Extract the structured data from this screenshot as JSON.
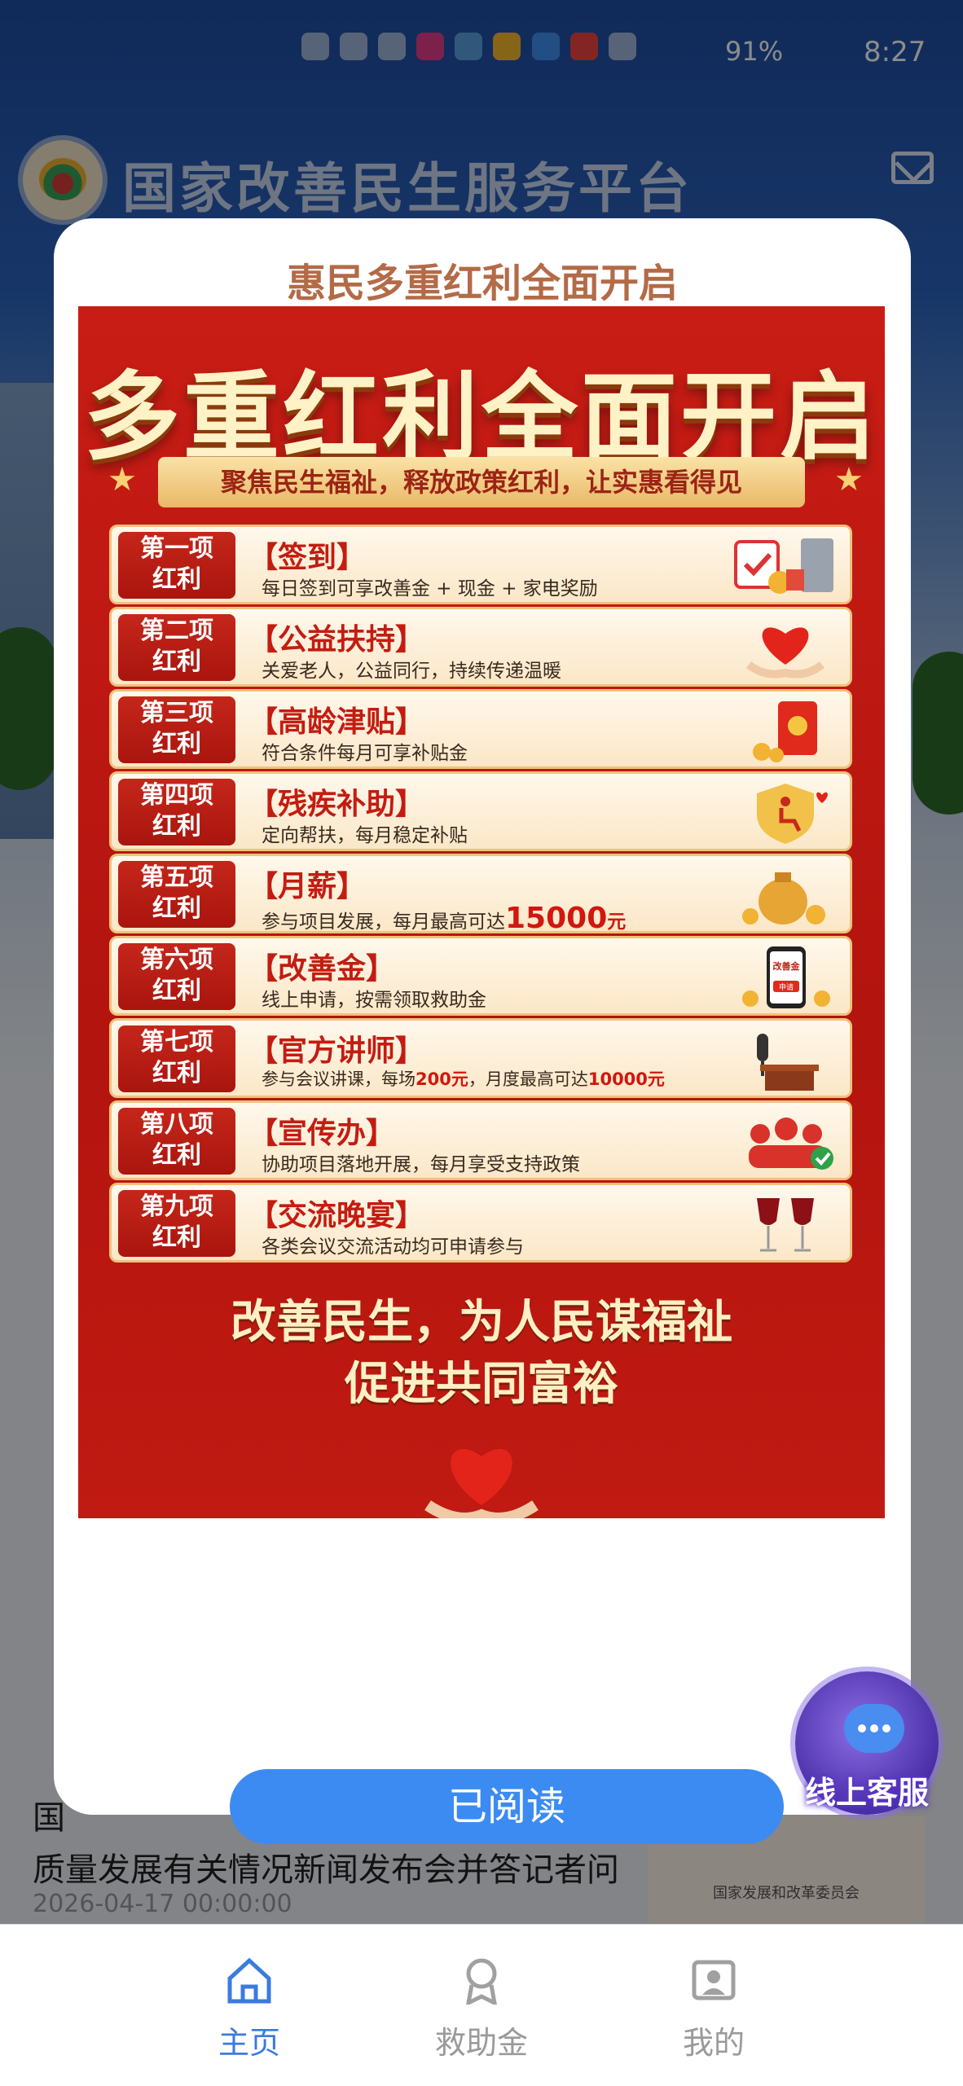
{
  "status_bar": {
    "time": "8:27",
    "battery": "91%"
  },
  "app": {
    "title": "国家改善民生服务平台"
  },
  "news": {
    "title": "国家发展改革委举行促进高质量发展有关情况新闻发布会并答记者问",
    "title_visible": "国\n质量发展有关情况新闻发布会并答记者问",
    "date": "2026-04-17 00:00:00",
    "thumb_caption": "国家发展和改革委员会"
  },
  "modal": {
    "title": "惠民多重红利全面开启",
    "poster_title": "多重红利全面开启",
    "ribbon": "聚焦民生福祉，释放政策红利，让实惠看得见",
    "rows": [
      {
        "badge": "第一项\n红利",
        "head": "【签到】",
        "desc": "每日签到可享改善金 + 现金 + 家电奖励"
      },
      {
        "badge": "第二项\n红利",
        "head": "【公益扶持】",
        "desc": "关爱老人，公益同行，持续传递温暖"
      },
      {
        "badge": "第三项\n红利",
        "head": "【高龄津贴】",
        "desc": "符合条件每月可享补贴金"
      },
      {
        "badge": "第四项\n红利",
        "head": "【残疾补助】",
        "desc": "定向帮扶，每月稳定补贴"
      },
      {
        "badge": "第五项\n红利",
        "head": "【月薪】",
        "desc": "参与项目发展，每月最高可达",
        "hl": "15000",
        "hl_unit": "元"
      },
      {
        "badge": "第六项\n红利",
        "head": "【改善金】",
        "desc": "线上申请，按需领取救助金"
      },
      {
        "badge": "第七项\n红利",
        "head": "【官方讲师】",
        "desc": "参与会议讲课，每场",
        "hl": "200",
        "hl_unit": "元",
        "desc2": "，月度最高可达",
        "hl2": "10000",
        "hl2_unit": "元"
      },
      {
        "badge": "第八项\n红利",
        "head": "【宣传办】",
        "desc": "协助项目落地开展，每月享受支持政策"
      },
      {
        "badge": "第九项\n红利",
        "head": "【交流晚宴】",
        "desc": "各类会议交流活动均可申请参与"
      }
    ],
    "slogan_line1": "改善民生，为人民谋福祉",
    "slogan_line2": "促进共同富裕",
    "art_labels": {
      "improve_fund": "改善金",
      "apply": "申请"
    },
    "confirm_button": "已阅读"
  },
  "service": {
    "label": "线上客服"
  },
  "bottom_nav": [
    {
      "label": "主页",
      "icon": "home-icon",
      "active": true
    },
    {
      "label": "救助金",
      "icon": "medal-icon",
      "active": false
    },
    {
      "label": "我的",
      "icon": "profile-icon",
      "active": false
    }
  ],
  "colors": {
    "accent": "#3b8bf2",
    "poster_red": "#c81d15",
    "gold": "#f7d173"
  }
}
